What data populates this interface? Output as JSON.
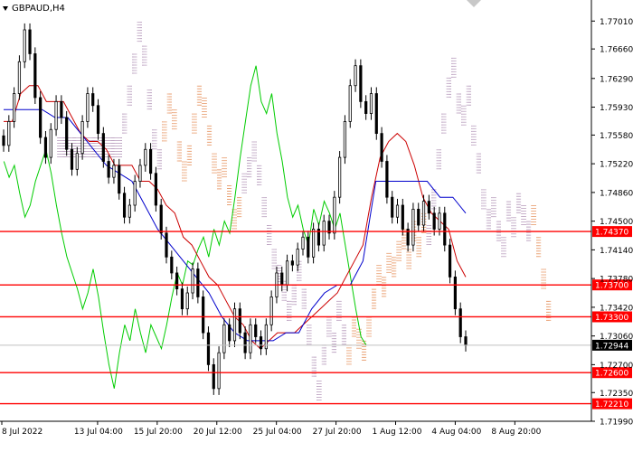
{
  "symbol": "GBPAUD,H4",
  "colors": {
    "background": "#ffffff",
    "candle": "#000000",
    "tenkan": "#cc0000",
    "kijun": "#0000cc",
    "chikou": "#00cc00",
    "cloud_bull": "#e07a3a",
    "cloud_bear": "#a37fa9",
    "level_line": "#ff0000",
    "level_label_bg": "#ff0000",
    "price_label_bg": "#000000"
  },
  "chart_data": {
    "type": "candlestick",
    "title": "GBPAUD,H4",
    "ylim": [
      1.7199,
      1.7724
    ],
    "y_ticks": [
      "1.77010",
      "1.76660",
      "1.76290",
      "1.75930",
      "1.75580",
      "1.75220",
      "1.74860",
      "1.74500",
      "1.74140",
      "1.73780",
      "1.73420",
      "1.73060",
      "1.72700",
      "1.72350",
      "1.71990"
    ],
    "x_ticks": [
      "8 Jul 2022",
      "13 Jul 04:00",
      "15 Jul 20:00",
      "20 Jul 12:00",
      "25 Jul 04:00",
      "27 Jul 20:00",
      "1 Aug 12:00",
      "4 Aug 04:00",
      "8 Aug 20:00"
    ],
    "levels": [
      {
        "label": "1.74370",
        "value": 1.7437
      },
      {
        "label": "1.73700",
        "value": 1.737
      },
      {
        "label": "1.73300",
        "value": 1.733
      },
      {
        "label": "1.72600",
        "value": 1.726
      },
      {
        "label": "1.72210",
        "value": 1.7221
      }
    ],
    "current_price": {
      "label": "1.72944",
      "value": 1.72944
    },
    "series": [
      {
        "name": "close",
        "values": [
          1.7545,
          1.7575,
          1.761,
          1.765,
          1.769,
          1.766,
          1.7605,
          1.7555,
          1.753,
          1.7565,
          1.76,
          1.758,
          1.754,
          1.7515,
          1.7535,
          1.7575,
          1.761,
          1.7595,
          1.756,
          1.7525,
          1.7505,
          1.752,
          1.7485,
          1.7455,
          1.747,
          1.75,
          1.752,
          1.754,
          1.751,
          1.747,
          1.7435,
          1.7405,
          1.7385,
          1.7365,
          1.734,
          1.736,
          1.739,
          1.7355,
          1.731,
          1.727,
          1.724,
          1.7285,
          1.732,
          1.73,
          1.734,
          1.731,
          1.7285,
          1.732,
          1.7305,
          1.729,
          1.732,
          1.7355,
          1.7385,
          1.737,
          1.74,
          1.7395,
          1.7415,
          1.743,
          1.7405,
          1.744,
          1.742,
          1.745,
          1.7435,
          1.748,
          1.753,
          1.7575,
          1.762,
          1.7645,
          1.76,
          1.7585,
          1.761,
          1.756,
          1.7525,
          1.748,
          1.7455,
          1.747,
          1.744,
          1.742,
          1.7465,
          1.7445,
          1.7475,
          1.746,
          1.744,
          1.746,
          1.742,
          1.738,
          1.734,
          1.7305,
          1.72944
        ]
      },
      {
        "name": "tenkan",
        "values": [
          1.7575,
          1.7575,
          1.761,
          1.762,
          1.762,
          1.76,
          1.76,
          1.76,
          1.758,
          1.756,
          1.755,
          1.755,
          1.754,
          1.752,
          1.752,
          1.752,
          1.75,
          1.75,
          1.749,
          1.747,
          1.746,
          1.743,
          1.742,
          1.74,
          1.738,
          1.737,
          1.735,
          1.733,
          1.732,
          1.73,
          1.729,
          1.73,
          1.731,
          1.731,
          1.731,
          1.732,
          1.733,
          1.734,
          1.735,
          1.736,
          1.738,
          1.74,
          1.742,
          1.748,
          1.753,
          1.755,
          1.756,
          1.755,
          1.752,
          1.748,
          1.746,
          1.745,
          1.744,
          1.74,
          1.738
        ]
      },
      {
        "name": "kijun",
        "values": [
          1.759,
          1.759,
          1.759,
          1.759,
          1.758,
          1.758,
          1.756,
          1.754,
          1.752,
          1.751,
          1.75,
          1.747,
          1.744,
          1.742,
          1.74,
          1.738,
          1.736,
          1.733,
          1.731,
          1.73,
          1.73,
          1.73,
          1.731,
          1.731,
          1.734,
          1.736,
          1.737,
          1.737,
          1.74,
          1.75,
          1.75,
          1.75,
          1.75,
          1.75,
          1.748,
          1.748,
          1.746
        ]
      }
    ]
  }
}
